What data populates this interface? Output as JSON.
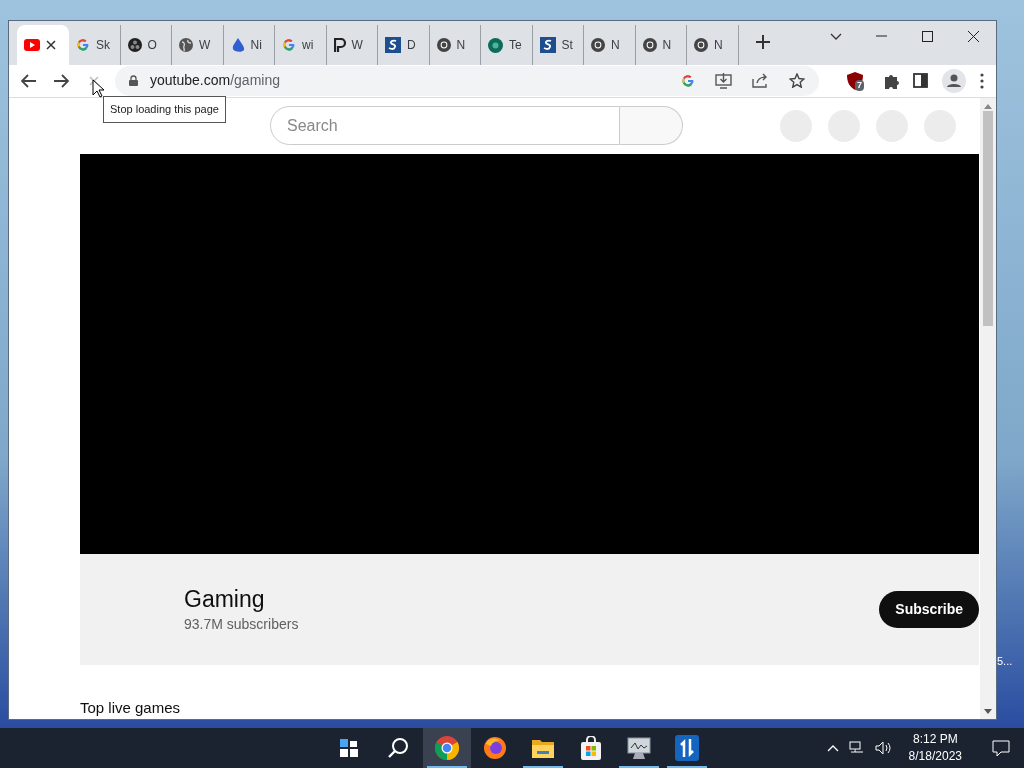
{
  "tabs": [
    {
      "kind": "youtube",
      "selected": true
    },
    {
      "kind": "google",
      "title": "Sk",
      "selected": false
    },
    {
      "kind": "dark",
      "title": "O",
      "selected": false
    },
    {
      "kind": "globe",
      "title": "W",
      "selected": false
    },
    {
      "kind": "drop",
      "title": "Ni",
      "selected": false
    },
    {
      "kind": "google",
      "title": "wi",
      "selected": false
    },
    {
      "kind": "p",
      "title": "W",
      "selected": false
    },
    {
      "kind": "s",
      "title": "D",
      "selected": false
    },
    {
      "kind": "chrome",
      "title": "N",
      "selected": false
    },
    {
      "kind": "te",
      "title": "Te",
      "selected": false
    },
    {
      "kind": "s",
      "title": "St",
      "selected": false
    },
    {
      "kind": "chrome",
      "title": "N",
      "selected": false
    },
    {
      "kind": "chrome",
      "title": "N",
      "selected": false
    },
    {
      "kind": "chrome",
      "title": "N",
      "selected": false
    }
  ],
  "address": {
    "host": "youtube.com",
    "path": "/gaming"
  },
  "extension_badge": "7",
  "tooltip": "Stop loading this page",
  "search": {
    "placeholder": "Search"
  },
  "channel": {
    "name": "Gaming",
    "subscribers": "93.7M subscribers",
    "subscribe": "Subscribe"
  },
  "section_heading": "Top live games",
  "desktop_label": "5...",
  "taskbar": {
    "apps": [
      {
        "kind": "chrome",
        "selected": true
      },
      {
        "kind": "firefox",
        "selected": false
      },
      {
        "kind": "folder",
        "selected": false
      },
      {
        "kind": "store",
        "selected": false
      },
      {
        "kind": "monitor",
        "selected": false
      },
      {
        "kind": "blue",
        "selected": false
      }
    ],
    "time": "8:12 PM",
    "date": "8/18/2023"
  }
}
